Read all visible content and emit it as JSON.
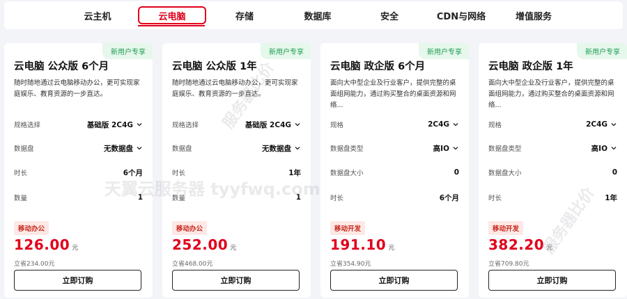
{
  "nav": {
    "tabs": [
      {
        "label": "云主机"
      },
      {
        "label": "云电脑"
      },
      {
        "label": "存储"
      },
      {
        "label": "数据库"
      },
      {
        "label": "安全"
      },
      {
        "label": "CDN与网络"
      },
      {
        "label": "增值服务"
      }
    ],
    "active_index": 1
  },
  "cards": [
    {
      "badge": "新用户专享",
      "title": "云电脑 公众版 6个月",
      "desc": "随时随地通过云电脑移动办公，更可实现家庭娱乐、教育资源的一步直达。",
      "rows": [
        {
          "label": "规格选择",
          "value": "基础版 2C4G"
        },
        {
          "label": "数据盘",
          "value": "无数据盘"
        },
        {
          "label": "时长",
          "value": "6个月"
        },
        {
          "label": "数量",
          "value": "1"
        }
      ],
      "tag": "移动办公",
      "price": "126.00",
      "unit": "元",
      "save": "立省234.00元",
      "button": "立即订购"
    },
    {
      "badge": "新用户专享",
      "title": "云电脑 公众版 1年",
      "desc": "随时随地通过云电脑移动办公，更可实现家庭娱乐、教育资源的一步直达。",
      "rows": [
        {
          "label": "规格选择",
          "value": "基础版 2C4G"
        },
        {
          "label": "数据盘",
          "value": "无数据盘"
        },
        {
          "label": "时长",
          "value": "1年"
        },
        {
          "label": "数量",
          "value": "1"
        }
      ],
      "tag": "移动办公",
      "price": "252.00",
      "unit": "元",
      "save": "立省468.00元",
      "button": "立即订购"
    },
    {
      "badge": "新用户专享",
      "title": "云电脑 政企版 6个月",
      "desc": "面向大中型企业及行业客户，提供完整的桌面组网能力，通过购买整合的桌面资源和网络...",
      "rows": [
        {
          "label": "规格",
          "value": "2C4G"
        },
        {
          "label": "数据盘类型",
          "value": "高IO"
        },
        {
          "label": "数据盘大小",
          "value": "0"
        },
        {
          "label": "时长",
          "value": "6个月"
        }
      ],
      "tag": "移动开发",
      "price": "191.10",
      "unit": "元",
      "save": "立省354.90元",
      "button": "立即订购"
    },
    {
      "badge": "新用户专享",
      "title": "云电脑 政企版 1年",
      "desc": "面向大中型企业及行业客户，提供完整的桌面组网能力，通过购买整合的桌面资源和网络...",
      "rows": [
        {
          "label": "规格",
          "value": "2C4G"
        },
        {
          "label": "数据盘类型",
          "value": "高IO"
        },
        {
          "label": "数据盘大小",
          "value": "0"
        },
        {
          "label": "时长",
          "value": "1年"
        }
      ],
      "tag": "移动开发",
      "price": "382.20",
      "unit": "元",
      "save": "立省709.80元",
      "button": "立即订购"
    }
  ],
  "watermarks": {
    "main": "天翼云服务器 tyyfwq.com",
    "diag1": "服务器比价",
    "diag2": "服务器比价"
  },
  "colors": {
    "accent": "#e0001b",
    "badge_green": "#1e9e54",
    "tag_bg": "#fde8e6"
  }
}
